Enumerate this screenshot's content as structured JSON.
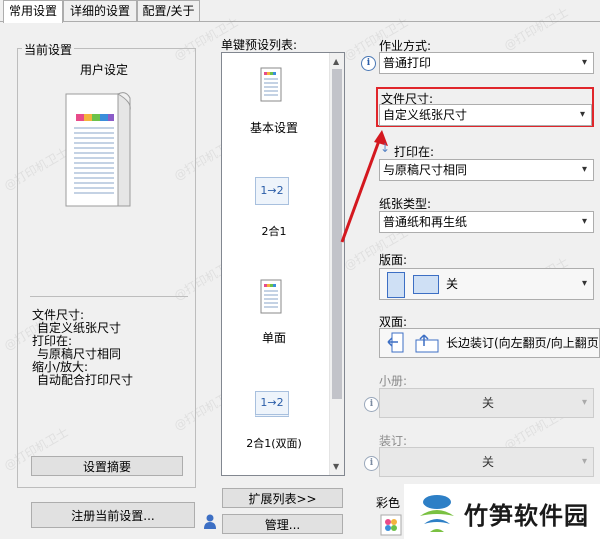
{
  "tabs": [
    "常用设置",
    "详细的设置",
    "配置/关于"
  ],
  "current_settings": {
    "group_title": "当前设置",
    "preview_caption": "用户设定",
    "summary": [
      {
        "label": "文件尺寸:",
        "value": "自定义纸张尺寸"
      },
      {
        "label": "打印在:",
        "value": "与原稿尺寸相同"
      },
      {
        "label": "缩小/放大:",
        "value": "自动配合打印尺寸"
      }
    ],
    "summary_button": "设置摘要",
    "register_button": "注册当前设置..."
  },
  "preset_list": {
    "title": "单键预设列表:",
    "items": [
      {
        "label": "基本设置",
        "icon": "document-icon"
      },
      {
        "label": "2合1",
        "icon": "two-in-one-icon",
        "glyph": "1→2"
      },
      {
        "label": "单面",
        "icon": "single-sided-icon"
      },
      {
        "label": "2合1(双面)",
        "icon": "two-in-one-duplex-icon",
        "glyph": "1→2"
      }
    ],
    "expand_button": "扩展列表>>",
    "manage_button": "管理..."
  },
  "job_mode": {
    "label": "作业方式:",
    "value": "普通打印"
  },
  "page_size": {
    "label": "文件尺寸:",
    "value": "自定义纸张尺寸"
  },
  "print_on": {
    "label": "打印在:",
    "value": "与原稿尺寸相同"
  },
  "paper_type": {
    "label": "纸张类型:",
    "value": "普通纸和再生纸"
  },
  "layout": {
    "label": "版面:",
    "value": "关"
  },
  "duplex": {
    "label": "双面:",
    "value": "长边装订(向左翻页/向上翻页)"
  },
  "booklet": {
    "label": "小册:",
    "value": "关"
  },
  "binding": {
    "label": "装订:",
    "value": "关"
  },
  "color": {
    "label": "彩色"
  },
  "watermark_text": "@打印机卫士",
  "brand": {
    "name": "竹笋软件园"
  },
  "colors": {
    "highlight_box": "#e0262b",
    "arrow": "#d4181f",
    "brand_blue": "#2d7fc6",
    "brand_green": "#7ac142"
  }
}
